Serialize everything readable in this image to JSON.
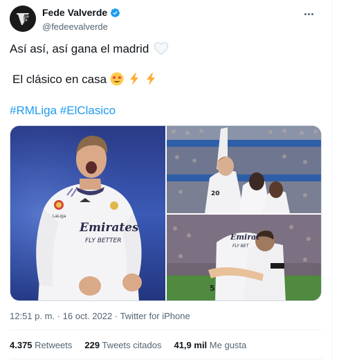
{
  "author": {
    "display_name": "Fede Valverde",
    "handle": "@fedeevalverde",
    "verified": true,
    "avatar_icon": "avatar-fv-logo"
  },
  "tweet": {
    "line1": "Así así, así gana el madrid",
    "line2": "El clásico en casa",
    "emoji_line1": "white-heart",
    "emoji_line2": [
      "star-struck",
      "high-voltage",
      "high-voltage"
    ],
    "hashtags": [
      "#RMLiga",
      "#ElClasico"
    ]
  },
  "media": {
    "count": 3,
    "items": [
      "player-celebrating-photo",
      "players-hugging-photo",
      "players-embracing-photo"
    ],
    "jersey_text": "Emirates FLY BETTER"
  },
  "meta": {
    "time": "12:51 p. m.",
    "separator": "·",
    "date": "16 oct. 2022",
    "source": "Twitter for iPhone"
  },
  "stats": {
    "retweets_count": "4.375",
    "retweets_label": "Retweets",
    "quotes_count": "229",
    "quotes_label": "Tweets citados",
    "likes_count": "41,9 mil",
    "likes_label": "Me gusta"
  },
  "colors": {
    "accent": "#1d9bf0",
    "text": "#0f1419",
    "secondary": "#536471"
  }
}
